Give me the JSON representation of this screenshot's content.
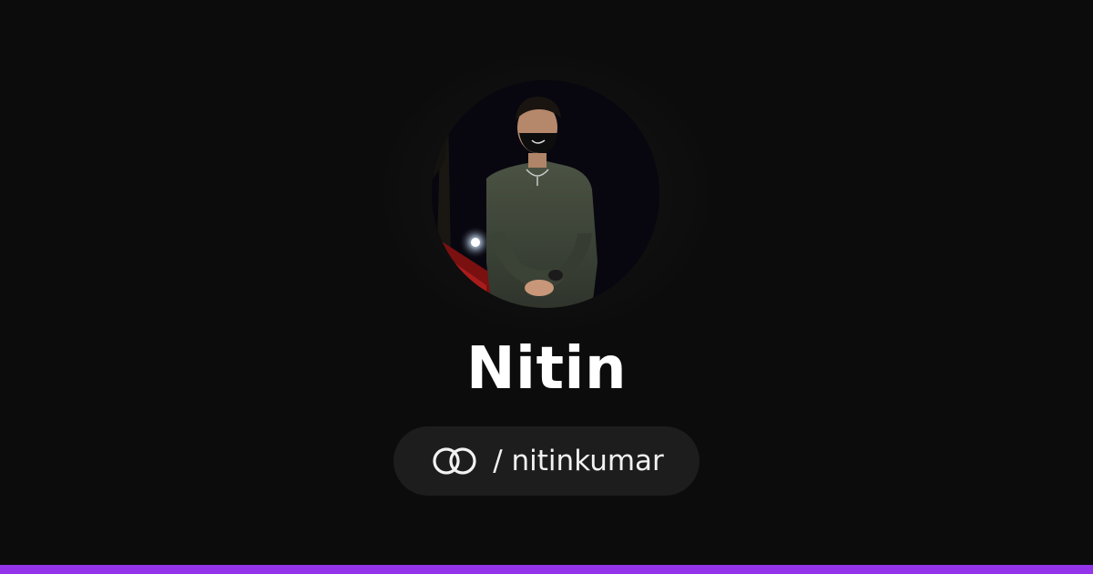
{
  "profile": {
    "name": "Nitin",
    "handle": "/ nitinkumar",
    "avatar_icon": "profile-photo"
  },
  "icons": {
    "link": "linked-rings-icon"
  },
  "colors": {
    "background": "#0c0c0c",
    "pill_background": "#1d1d1d",
    "accent_bar": "#9333ea",
    "text": "#ffffff"
  }
}
